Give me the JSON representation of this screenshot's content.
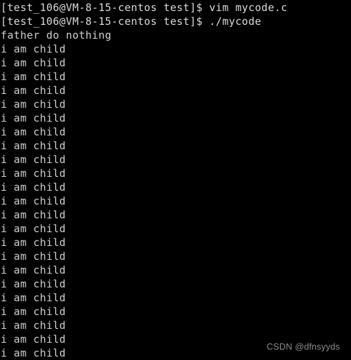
{
  "terminal": {
    "background_color": "#000000",
    "text_color": "#d6d6d6",
    "lines": [
      {
        "type": "prompt",
        "text": "[test_106@VM-8-15-centos test]$ vim mycode.c"
      },
      {
        "type": "prompt",
        "text": "[test_106@VM-8-15-centos test]$ ./mycode"
      },
      {
        "type": "output",
        "text": "father do nothing"
      },
      {
        "type": "output",
        "text": "i am child"
      },
      {
        "type": "output",
        "text": "i am child"
      },
      {
        "type": "output",
        "text": "i am child"
      },
      {
        "type": "output",
        "text": "i am child"
      },
      {
        "type": "output",
        "text": "i am child"
      },
      {
        "type": "output",
        "text": "i am child"
      },
      {
        "type": "output",
        "text": "i am child"
      },
      {
        "type": "output",
        "text": "i am child"
      },
      {
        "type": "output",
        "text": "i am child"
      },
      {
        "type": "output",
        "text": "i am child"
      },
      {
        "type": "output",
        "text": "i am child"
      },
      {
        "type": "output",
        "text": "i am child"
      },
      {
        "type": "output",
        "text": "i am child"
      },
      {
        "type": "output",
        "text": "i am child"
      },
      {
        "type": "output",
        "text": "i am child"
      },
      {
        "type": "output",
        "text": "i am child"
      },
      {
        "type": "output",
        "text": "i am child"
      },
      {
        "type": "output",
        "text": "i am child"
      },
      {
        "type": "output",
        "text": "i am child"
      },
      {
        "type": "output",
        "text": "i am child"
      },
      {
        "type": "output",
        "text": "i am child"
      },
      {
        "type": "output",
        "text": "i am child"
      },
      {
        "type": "output",
        "text": "i am child"
      }
    ]
  },
  "watermark": {
    "text": "CSDN @dfnsyyds",
    "color": "#8a8a8a"
  }
}
